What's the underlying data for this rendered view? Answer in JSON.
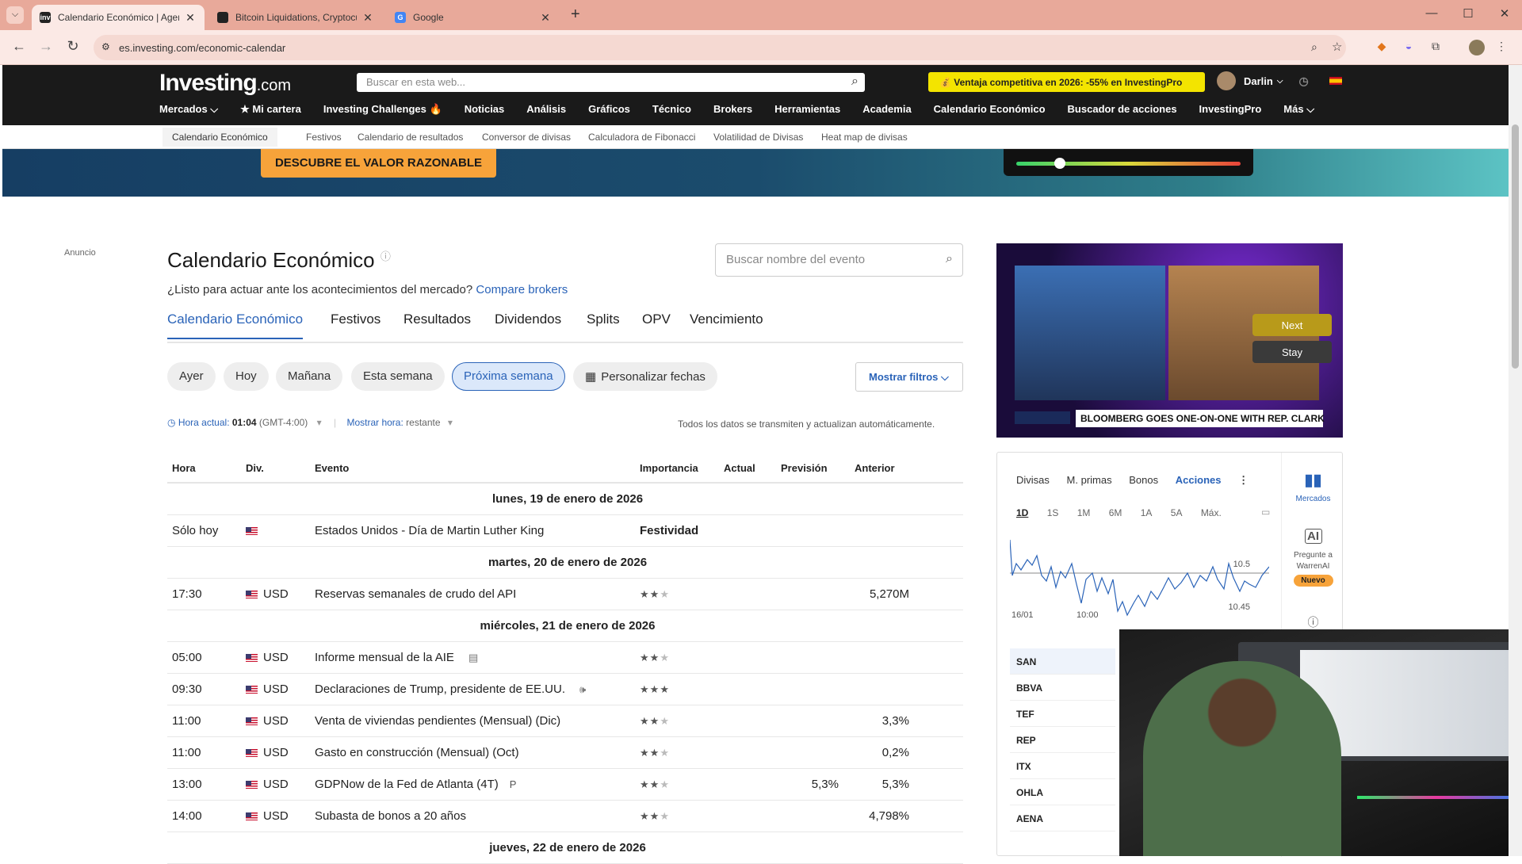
{
  "browser": {
    "tabs": [
      {
        "title": "Calendario Económico | Agenda",
        "fav": "inv"
      },
      {
        "title": "Bitcoin Liquidations, Cryptocur",
        "fav": ""
      },
      {
        "title": "Google",
        "fav": "G"
      }
    ],
    "new_tab": "+",
    "url": "es.investing.com/economic-calendar"
  },
  "site": {
    "logo": "Investing",
    "logo_suffix": ".com",
    "search_placeholder": "Buscar en esta web...",
    "promo": "💰 Ventaja competitiva en 2026: -55% en InvestingPro",
    "user": "Darlin",
    "nav": [
      "Mercados ⌵",
      "★ Mi cartera",
      "Investing Challenges 🔥",
      "Noticias",
      "Análisis",
      "Gráficos",
      "Técnico",
      "Brokers",
      "Herramientas",
      "Academia",
      "Calendario Económico",
      "Buscador de acciones",
      "InvestingPro",
      "Más ⌵"
    ],
    "subnav": [
      "Calendario Económico",
      "Festivos",
      "Calendario de resultados",
      "Conversor de divisas",
      "Calculadora de Fibonacci",
      "Volatilidad de Divisas",
      "Heat map de divisas"
    ]
  },
  "banner": {
    "button": "DESCUBRE EL VALOR RAZONABLE"
  },
  "main": {
    "ad_label": "Anuncio",
    "title": "Calendario Económico",
    "subtitle": "¿Listo para actuar ante los acontecimientos del mercado?",
    "subtitle_link": "Compare brokers",
    "event_search_placeholder": "Buscar nombre del evento",
    "tabs": [
      "Calendario Económico",
      "Festivos",
      "Resultados",
      "Dividendos",
      "Splits",
      "OPV",
      "Vencimiento"
    ],
    "filters": [
      "Ayer",
      "Hoy",
      "Mañana",
      "Esta semana",
      "Próxima semana",
      "Personalizar fechas"
    ],
    "show_filters": "Mostrar filtros",
    "time_label": "Hora actual:",
    "time_value": "01:04",
    "time_zone": "(GMT-4:00)",
    "show_time": "Mostrar hora:",
    "show_time_value": "restante",
    "auto_update": "Todos los datos se transmiten y actualizan automáticamente.",
    "columns": [
      "Hora",
      "Div.",
      "Evento",
      "Importancia",
      "Actual",
      "Previsión",
      "Anterior"
    ],
    "days": [
      {
        "date": "lunes, 19 de enero de 2026",
        "events": [
          {
            "time": "Sólo hoy",
            "cur": "",
            "event": "Estados Unidos - Día de Martin Luther King",
            "holiday": "Festividad",
            "imp": 0,
            "actual": "",
            "forecast": "",
            "previous": ""
          }
        ]
      },
      {
        "date": "martes, 20 de enero de 2026",
        "events": [
          {
            "time": "17:30",
            "cur": "USD",
            "event": "Reservas semanales de crudo del API",
            "imp": 2,
            "actual": "",
            "forecast": "",
            "previous": "5,270M"
          }
        ]
      },
      {
        "date": "miércoles, 21 de enero de 2026",
        "events": [
          {
            "time": "05:00",
            "cur": "USD",
            "event": "Informe mensual de la AIE",
            "icon": "document-icon",
            "imp": 2,
            "actual": "",
            "forecast": "",
            "previous": ""
          },
          {
            "time": "09:30",
            "cur": "USD",
            "event": "Declaraciones de Trump, presidente de EE.UU.",
            "icon": "speaker-icon",
            "imp": 3,
            "actual": "",
            "forecast": "",
            "previous": ""
          },
          {
            "time": "11:00",
            "cur": "USD",
            "event": "Venta de viviendas pendientes (Mensual) (Dic)",
            "imp": 2,
            "actual": "",
            "forecast": "",
            "previous": "3,3%"
          },
          {
            "time": "11:00",
            "cur": "USD",
            "event": "Gasto en construcción (Mensual) (Oct)",
            "imp": 2,
            "actual": "",
            "forecast": "",
            "previous": "0,2%"
          },
          {
            "time": "13:00",
            "cur": "USD",
            "event": "GDPNow de la Fed de Atlanta  (4T)",
            "mark": "P",
            "imp": 2,
            "actual": "",
            "forecast": "5,3%",
            "previous": "5,3%"
          },
          {
            "time": "14:00",
            "cur": "USD",
            "event": "Subasta de bonos a 20 años",
            "imp": 2,
            "actual": "",
            "forecast": "",
            "previous": "4,798%"
          }
        ]
      },
      {
        "date": "jueves, 22 de enero de 2026",
        "events": []
      }
    ]
  },
  "video": {
    "next": "Next",
    "stay": "Stay",
    "caption": "BLOOMBERG GOES ONE-ON-ONE WITH REP. CLARK"
  },
  "markets": {
    "tabs": [
      "Divisas",
      "M. primas",
      "Bonos",
      "Acciones"
    ],
    "ranges": [
      "1D",
      "1S",
      "1M",
      "6M",
      "1A",
      "5A",
      "Máx."
    ],
    "chart_labels": {
      "y_high": "10.5",
      "y_low": "10.45",
      "x_start": "16/01",
      "x_mid": "10:00"
    },
    "rail": {
      "markets": "Mercados",
      "ask": "Pregunte a WarrenAI",
      "new_badge": "Nuevo"
    },
    "stocks": [
      "SAN",
      "BBVA",
      "TEF",
      "REP",
      "ITX",
      "OHLA",
      "AENA"
    ]
  }
}
